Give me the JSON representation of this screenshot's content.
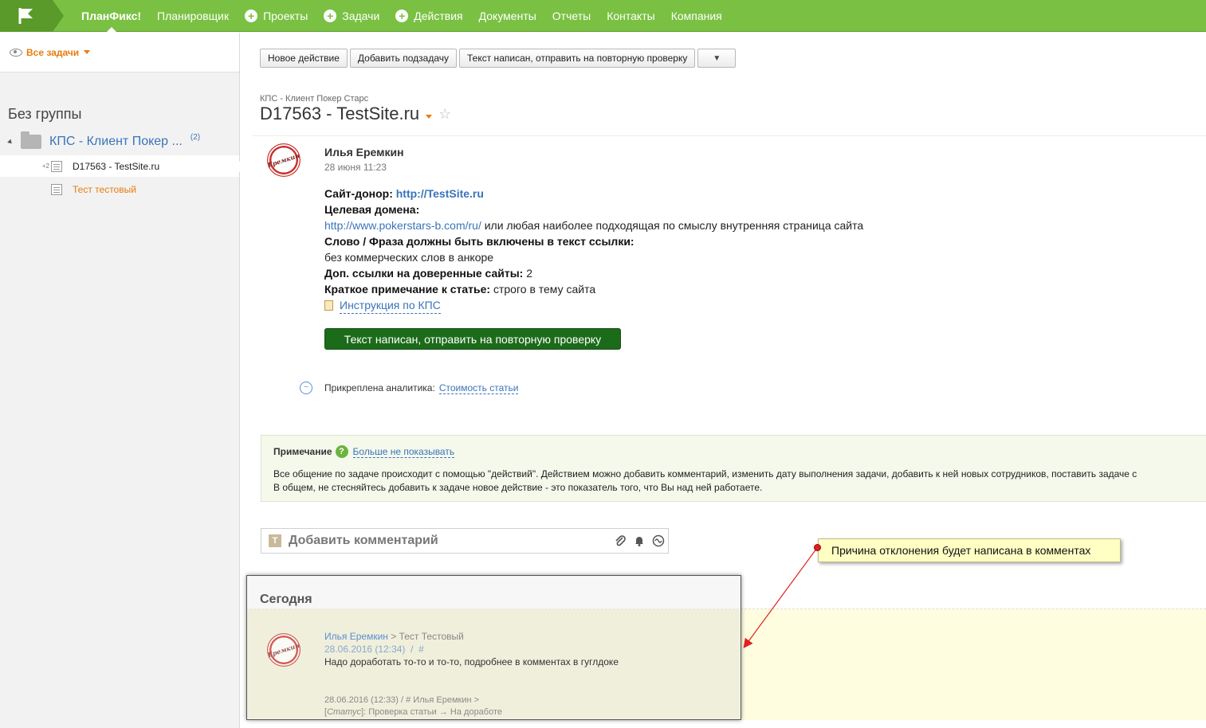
{
  "nav": {
    "items": [
      {
        "label": "ПланФикс!",
        "plus": false,
        "active": true
      },
      {
        "label": "Планировщик",
        "plus": false
      },
      {
        "label": "Проекты",
        "plus": true
      },
      {
        "label": "Задачи",
        "plus": true
      },
      {
        "label": "Действия",
        "plus": true
      },
      {
        "label": "Документы",
        "plus": false
      },
      {
        "label": "Отчеты",
        "plus": false
      },
      {
        "label": "Контакты",
        "plus": false
      },
      {
        "label": "Компания",
        "plus": false
      }
    ]
  },
  "sidebar": {
    "filter_label": "Все задачи",
    "group_title": "Без группы",
    "project_name": "КПС - Клиент Покер ...",
    "project_count": "(2)",
    "tasks": [
      {
        "badge": "+2",
        "name": "D17563 - TestSite.ru",
        "selected": true,
        "color": "#222222"
      },
      {
        "badge": "",
        "name": "Тест тестовый",
        "selected": false,
        "color": "#e87c0e"
      }
    ]
  },
  "toolbar": {
    "buttons": [
      "Новое действие",
      "Добавить подзадачу",
      "Текст написан, отправить на повторную проверку"
    ],
    "dropdown": "▼"
  },
  "task": {
    "breadcrumb": "КПС - Клиент Покер Старс",
    "title": "D17563 - TestSite.ru",
    "avatar_text": "Еремкин",
    "author": "Илья Еремкин",
    "date": "28 июня 11:23",
    "donor_label": "Сайт-донор:",
    "donor_link": "http://TestSite.ru",
    "target_label": "Целевая домена:",
    "target_link": "http://www.pokerstars-b.com/ru/",
    "target_rest": " или любая наиболее подходящая по смыслу внутренняя страница сайта",
    "phrase_label": "Слово / Фраза должны быть включены в текст ссылки:",
    "phrase_value": "без коммерческих слов в анкоре",
    "extra_label": "Доп. ссылки на доверенные сайты:",
    "extra_value": " 2",
    "note_label": "Краткое примечание к статье:",
    "note_value": " строго в тему сайта",
    "instruction_link": "Инструкция по КПС",
    "action_button": "Текст написан, отправить на повторную проверку",
    "analytics_label": "Прикреплена аналитика:",
    "analytics_link": "Стоимость статьи"
  },
  "note": {
    "title": "Примечание",
    "dismiss": "Больше не показывать",
    "line1": "Все общение по задаче происходит с помощью \"действий\". Действием можно добавить комментарий, изменить дату выполнения задачи, добавить к ней новых сотрудников, поставить задаче с",
    "line2": "В общем, не стесняйтесь добавить к задаче новое действие - это показатель того, что Вы над ней работаете."
  },
  "comment": {
    "icon_letter": "T",
    "placeholder": "Добавить комментарий",
    "attach_icon": "paperclip-icon",
    "bell_icon": "bell-icon",
    "analytics_icon": "analytics-icon"
  },
  "history": {
    "today": "Сегодня",
    "author": "Илья Еремкин",
    "arrow": " > ",
    "recipient": "Тест Тестовый",
    "date": "28.06.2016 (12:34)",
    "hash": "#",
    "text": "Надо доработать то-то и то-то, подробнее в комментах в гуглдоке",
    "status_line1": "28.06.2016 (12:33)  /  #     Илья Еремкин >",
    "status_label": "Статус",
    "status_line2": ": Проверка статьи → На доработе"
  },
  "annotation": {
    "callout_text": "Причина отклонения будет написана в комментах"
  },
  "colors": {
    "brand_green": "#7ac143",
    "accent_orange": "#e87c0e",
    "link_blue": "#3b73b9",
    "action_green": "#1c6b1a"
  }
}
